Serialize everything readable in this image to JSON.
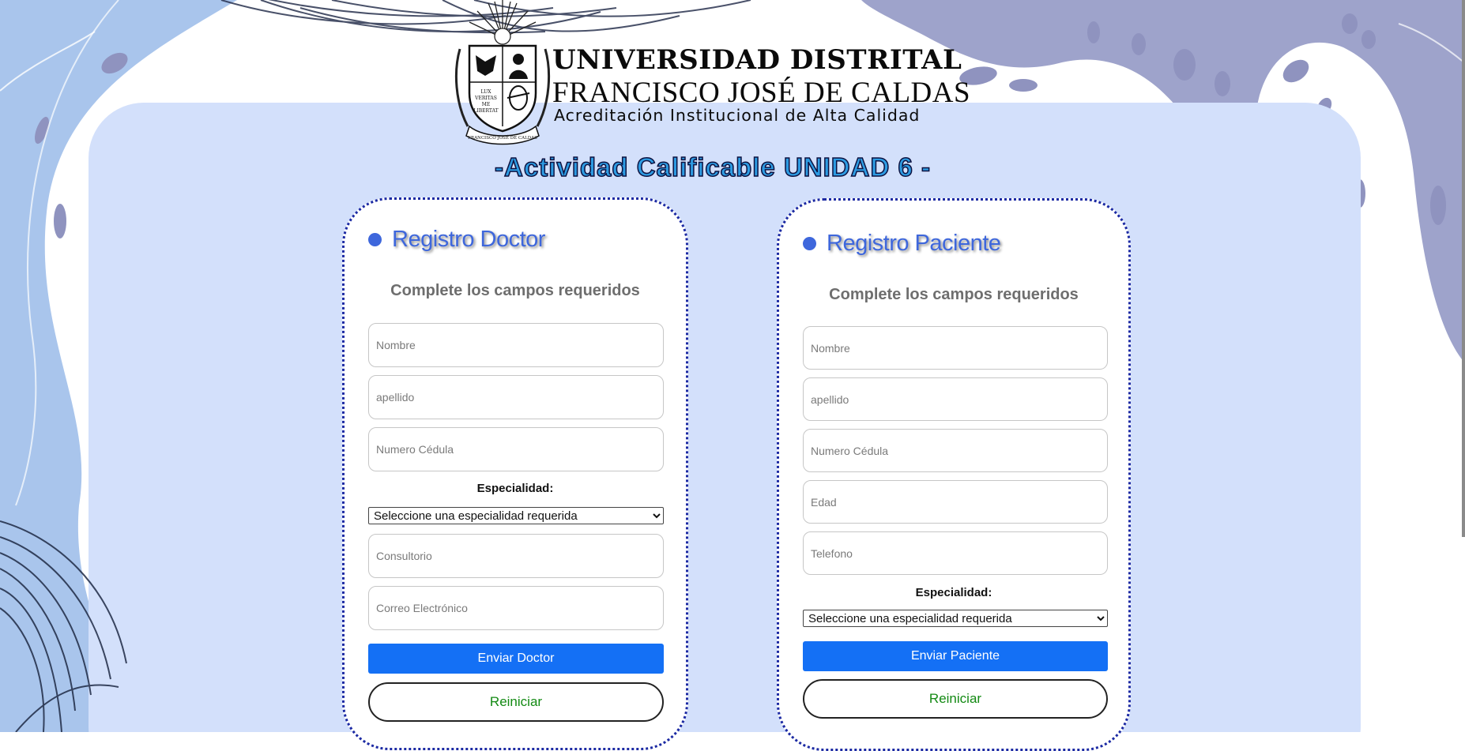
{
  "header": {
    "university_name_line1": "UNIVERSIDAD DISTRITAL",
    "university_name_line2": "FRANCISCO JOSÉ DE CALDAS",
    "accreditation": "Acreditación Institucional de Alta Calidad",
    "seal_text": {
      "top": "LUX",
      "middle": "VERITAS",
      "mid2": "ME",
      "bottom": "LIBERTAT",
      "ring": "FRANCISCO JOSÉ DE CALDAS"
    }
  },
  "page_title": "-Actividad Calificable UNIDAD 6 -",
  "doctor_form": {
    "heading": "Registro Doctor",
    "subtitle": "Complete los campos requeridos",
    "fields": {
      "nombre_placeholder": "Nombre",
      "apellido_placeholder": "apellido",
      "cedula_placeholder": "Numero Cédula",
      "consultorio_placeholder": "Consultorio",
      "correo_placeholder": "Correo Electrónico"
    },
    "especialidad_label": "Especialidad:",
    "especialidad_selected": "Seleccione una especialidad requerida",
    "submit_label": "Enviar Doctor",
    "reset_label": "Reiniciar"
  },
  "paciente_form": {
    "heading": "Registro Paciente",
    "subtitle": "Complete los campos requeridos",
    "fields": {
      "nombre_placeholder": "Nombre",
      "apellido_placeholder": "apellido",
      "cedula_placeholder": "Numero Cédula",
      "edad_placeholder": "Edad",
      "telefono_placeholder": "Telefono"
    },
    "especialidad_label": "Especialidad:",
    "especialidad_selected": "Seleccione una especialidad requerida",
    "submit_label": "Enviar Paciente",
    "reset_label": "Reiniciar"
  },
  "colors": {
    "page_panel": "#d3e0fb",
    "blob_light": "#a9c5ec",
    "blob_dark": "#9ea3cb",
    "accent_blue": "#3e67dc",
    "button_blue": "#1470f5",
    "reset_text_green": "#138a13",
    "title_fill": "#2d9be2"
  }
}
